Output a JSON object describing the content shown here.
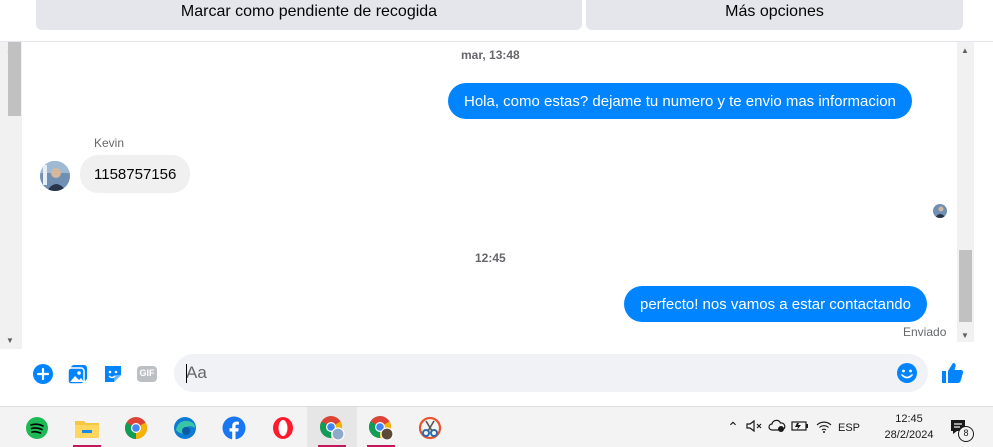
{
  "actions": {
    "pending_label": "Marcar como pendiente de recogida",
    "more_label": "Más opciones"
  },
  "conversation": {
    "timestamp_1": "mar, 13:48",
    "outgoing_1": "Hola, como estas? dejame tu numero y te envio mas informacion",
    "incoming_sender": "Kevin",
    "incoming_1": "1158757156",
    "timestamp_2": "12:45",
    "outgoing_2": "perfecto! nos vamos a estar contactando",
    "delivery_status": "Enviado"
  },
  "composer": {
    "placeholder": "Aa",
    "gif_label": "GIF"
  },
  "taskbar": {
    "apps": [
      "spotify-icon",
      "file-explorer-icon",
      "chrome-icon",
      "edge-icon",
      "facebook-icon",
      "opera-icon",
      "chrome-profile-icon",
      "chrome-profile-2-icon",
      "snipping-tool-icon"
    ],
    "language": "ESP",
    "time": "12:45",
    "date": "28/2/2024",
    "notification_count": "8"
  },
  "colors": {
    "messenger_blue": "#0084ff",
    "incoming_bubble": "#f0f0f0",
    "button_gray": "#e4e6eb"
  }
}
